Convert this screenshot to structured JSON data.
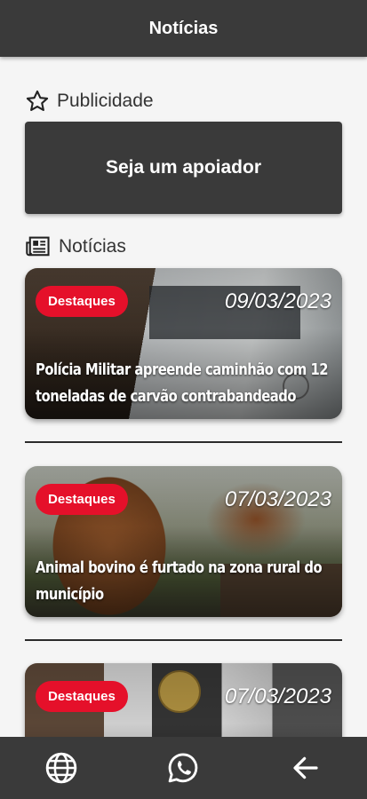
{
  "appbar": {
    "title": "Notícias"
  },
  "sections": {
    "ads_label": "Publicidade",
    "promo_label": "Seja um apoiador",
    "news_label": "Notícias"
  },
  "news": [
    {
      "badge": "Destaques",
      "date": "09/03/2023",
      "title": "Polícia Militar apreende caminhão com 12 toneladas de carvão contrabandeado"
    },
    {
      "badge": "Destaques",
      "date": "07/03/2023",
      "title": "Animal bovino é furtado na zona rural do município"
    },
    {
      "badge": "Destaques",
      "date": "07/03/2023",
      "title": ""
    }
  ],
  "bottom_nav": {
    "icons": [
      "globe-icon",
      "whatsapp-icon",
      "arrow-back-icon"
    ]
  },
  "colors": {
    "bar": "#3a3a3a",
    "badge": "#e5102a",
    "background": "#f5f5f5"
  }
}
